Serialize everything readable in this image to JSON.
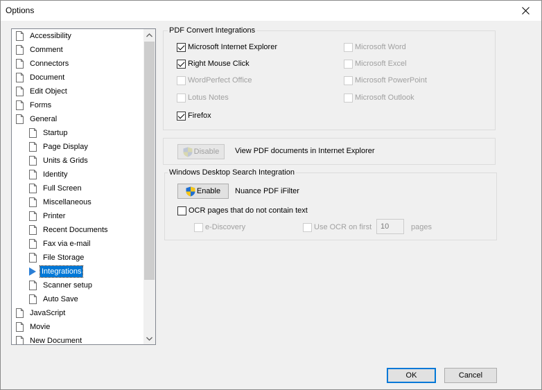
{
  "window": {
    "title": "Options"
  },
  "tree": {
    "items": [
      {
        "label": "Accessibility",
        "level": 0,
        "selected": false
      },
      {
        "label": "Comment",
        "level": 0,
        "selected": false
      },
      {
        "label": "Connectors",
        "level": 0,
        "selected": false
      },
      {
        "label": "Document",
        "level": 0,
        "selected": false
      },
      {
        "label": "Edit Object",
        "level": 0,
        "selected": false
      },
      {
        "label": "Forms",
        "level": 0,
        "selected": false
      },
      {
        "label": "General",
        "level": 0,
        "selected": false
      },
      {
        "label": "Startup",
        "level": 1,
        "selected": false
      },
      {
        "label": "Page Display",
        "level": 1,
        "selected": false
      },
      {
        "label": "Units & Grids",
        "level": 1,
        "selected": false
      },
      {
        "label": "Identity",
        "level": 1,
        "selected": false
      },
      {
        "label": "Full Screen",
        "level": 1,
        "selected": false
      },
      {
        "label": "Miscellaneous",
        "level": 1,
        "selected": false
      },
      {
        "label": "Printer",
        "level": 1,
        "selected": false
      },
      {
        "label": "Recent Documents",
        "level": 1,
        "selected": false
      },
      {
        "label": "Fax via e-mail",
        "level": 1,
        "selected": false
      },
      {
        "label": "File Storage",
        "level": 1,
        "selected": false
      },
      {
        "label": "Integrations",
        "level": 1,
        "selected": true
      },
      {
        "label": "Scanner setup",
        "level": 1,
        "selected": false
      },
      {
        "label": "Auto Save",
        "level": 1,
        "selected": false
      },
      {
        "label": "JavaScript",
        "level": 0,
        "selected": false
      },
      {
        "label": "Movie",
        "level": 0,
        "selected": false
      },
      {
        "label": "New Document",
        "level": 0,
        "selected": false
      }
    ]
  },
  "pdf_convert": {
    "title": "PDF Convert Integrations",
    "left": [
      {
        "label": "Microsoft Internet Explorer",
        "checked": true,
        "enabled": true
      },
      {
        "label": "Right Mouse Click",
        "checked": true,
        "enabled": true
      },
      {
        "label": "WordPerfect Office",
        "checked": false,
        "enabled": false
      },
      {
        "label": "Lotus Notes",
        "checked": false,
        "enabled": false
      },
      {
        "label": "Firefox",
        "checked": true,
        "enabled": true
      }
    ],
    "right": [
      {
        "label": "Microsoft Word",
        "checked": false,
        "enabled": false
      },
      {
        "label": "Microsoft Excel",
        "checked": false,
        "enabled": false
      },
      {
        "label": "Microsoft PowerPoint",
        "checked": false,
        "enabled": false
      },
      {
        "label": "Microsoft Outlook",
        "checked": false,
        "enabled": false
      }
    ]
  },
  "ie_view": {
    "button_label": "Disable",
    "description": "View PDF documents in Internet Explorer"
  },
  "desktop_search": {
    "title": "Windows Desktop Search Integration",
    "button_label": "Enable",
    "description": "Nuance PDF iFilter",
    "ocr_label": "OCR pages that do not contain text",
    "ediscovery_label": "e-Discovery",
    "use_ocr_label": "Use OCR on first",
    "pages_value": "10",
    "pages_label": "pages"
  },
  "footer": {
    "ok_label": "OK",
    "cancel_label": "Cancel"
  },
  "colors": {
    "selection": "#0078d7",
    "window_bg": "#f0f0f0"
  }
}
